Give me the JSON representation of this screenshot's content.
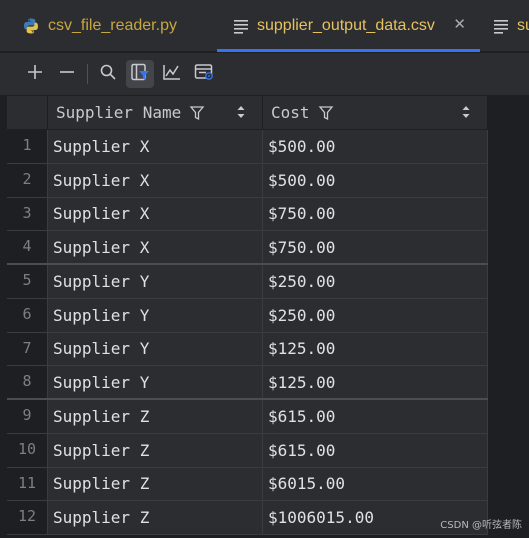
{
  "tabs": [
    {
      "label": "csv_file_reader.py",
      "icon": "python-file-icon",
      "active": false
    },
    {
      "label": "supplier_output_data.csv",
      "icon": "csv-file-icon",
      "active": true
    },
    {
      "label": "su",
      "icon": "csv-file-icon",
      "active": false
    }
  ],
  "toolbar": {
    "buttons": [
      "add-row-icon",
      "remove-row-icon",
      "search-icon",
      "filter-columns-icon",
      "chart-icon",
      "data-view-icon"
    ]
  },
  "grid": {
    "columns": [
      "Supplier Name",
      "Cost"
    ],
    "rows": [
      {
        "num": "1",
        "name": "Supplier X",
        "cost": "$500.00"
      },
      {
        "num": "2",
        "name": "Supplier X",
        "cost": "$500.00"
      },
      {
        "num": "3",
        "name": "Supplier X",
        "cost": "$750.00"
      },
      {
        "num": "4",
        "name": "Supplier X",
        "cost": "$750.00"
      },
      {
        "num": "5",
        "name": "Supplier Y",
        "cost": "$250.00"
      },
      {
        "num": "6",
        "name": "Supplier Y",
        "cost": "$250.00"
      },
      {
        "num": "7",
        "name": "Supplier Y",
        "cost": "$125.00"
      },
      {
        "num": "8",
        "name": "Supplier Y",
        "cost": "$125.00"
      },
      {
        "num": "9",
        "name": "Supplier Z",
        "cost": "$615.00"
      },
      {
        "num": "10",
        "name": "Supplier Z",
        "cost": "$615.00"
      },
      {
        "num": "11",
        "name": "Supplier Z",
        "cost": "$6015.00"
      },
      {
        "num": "12",
        "name": "Supplier Z",
        "cost": "$1006015.00"
      }
    ]
  },
  "watermark": "CSDN @听弦者陈",
  "colors": {
    "accent": "#3574f0",
    "tab_text": "#e7c15e",
    "background": "#1e1f22",
    "panel": "#2b2d30"
  }
}
